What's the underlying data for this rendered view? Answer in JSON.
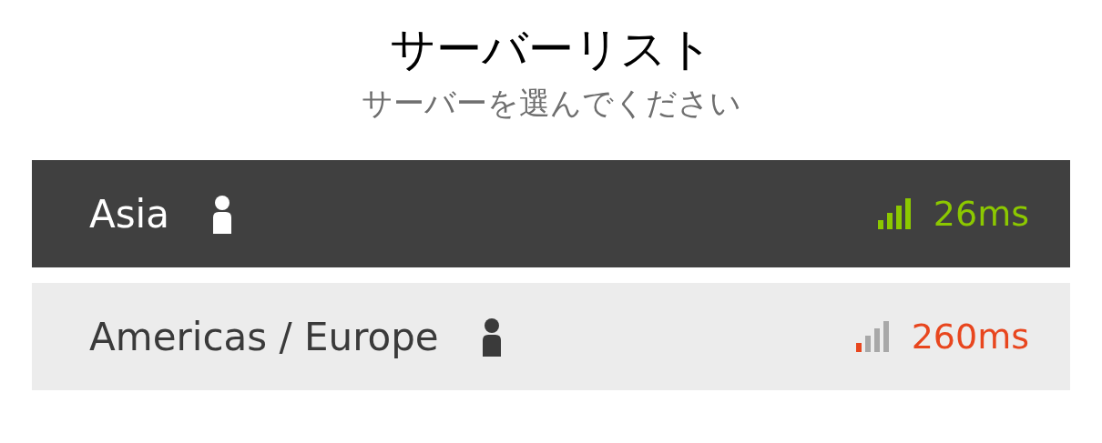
{
  "title": "サーバーリスト",
  "subtitle": "サーバーを選んでください",
  "servers": [
    {
      "name": "Asia",
      "selected": true,
      "kind": "good",
      "ping": "26ms"
    },
    {
      "name": "Americas / Europe",
      "selected": false,
      "kind": "poor",
      "ping": "260ms"
    }
  ]
}
